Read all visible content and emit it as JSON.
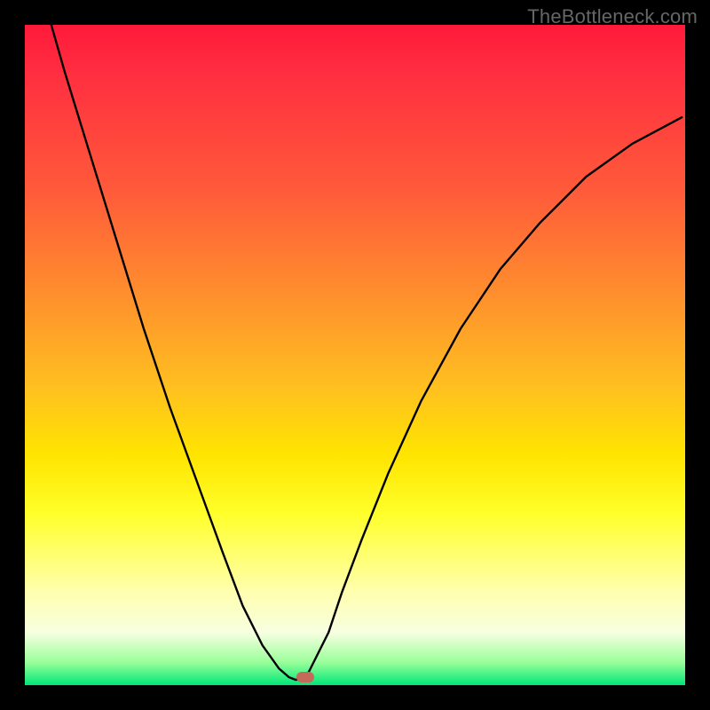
{
  "watermark": "TheBottleneck.com",
  "chart_data": {
    "type": "line",
    "title": "",
    "xlabel": "",
    "ylabel": "",
    "xlim": [
      0,
      100
    ],
    "ylim": [
      0,
      100
    ],
    "series": [
      {
        "name": "curve",
        "x": [
          4,
          6,
          10,
          14,
          18,
          22,
          26,
          30,
          33,
          36,
          38.5,
          40,
          41,
          42,
          43,
          46,
          48,
          51,
          55,
          60,
          66,
          72,
          78,
          85,
          92,
          99.5
        ],
        "y": [
          100,
          93,
          80,
          67,
          54,
          42,
          31,
          20,
          12,
          6,
          2.5,
          1.2,
          0.8,
          1.0,
          2.0,
          8,
          14,
          22,
          32,
          43,
          54,
          63,
          70,
          77,
          82,
          86
        ]
      }
    ],
    "gradient_stops": [
      {
        "pos": 0.0,
        "color": "#ff1a3a"
      },
      {
        "pos": 0.08,
        "color": "#ff3040"
      },
      {
        "pos": 0.25,
        "color": "#ff5a3a"
      },
      {
        "pos": 0.4,
        "color": "#ff8c2e"
      },
      {
        "pos": 0.55,
        "color": "#ffc020"
      },
      {
        "pos": 0.65,
        "color": "#ffe400"
      },
      {
        "pos": 0.74,
        "color": "#ffff2a"
      },
      {
        "pos": 0.86,
        "color": "#ffffb0"
      },
      {
        "pos": 0.92,
        "color": "#f7ffe0"
      },
      {
        "pos": 0.965,
        "color": "#9bff9b"
      },
      {
        "pos": 1.0,
        "color": "#00e676"
      }
    ],
    "marker": {
      "x": 42.5,
      "y": 1.2,
      "color": "#c46a5a"
    },
    "background": "#000000"
  }
}
